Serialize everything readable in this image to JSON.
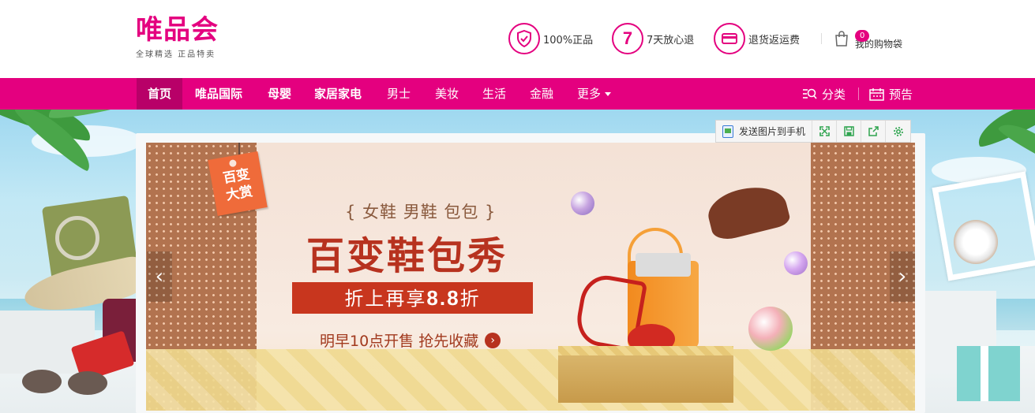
{
  "header": {
    "logo": {
      "main": "唯品会",
      "tagline": "全球精选  正品特卖"
    },
    "promises": [
      {
        "icon": "shield-icon",
        "text": "100%正品"
      },
      {
        "icon": "seven-day-icon",
        "badge": "7",
        "text": "7天放心退"
      },
      {
        "icon": "card-icon",
        "text": "退货返运费"
      }
    ],
    "cart": {
      "count": "0",
      "label": "我的购物袋"
    }
  },
  "nav": {
    "items": [
      {
        "label": "首页",
        "active": true
      },
      {
        "label": "唯品国际"
      },
      {
        "label": "母婴"
      },
      {
        "label": "家居家电"
      },
      {
        "label": "男士"
      },
      {
        "label": "美妆"
      },
      {
        "label": "生活"
      },
      {
        "label": "金融"
      },
      {
        "label": "更多"
      }
    ],
    "category": "分类",
    "preview": "预告"
  },
  "toolbar": {
    "send_label": "发送图片到手机"
  },
  "banner": {
    "tag": "百变\n大赏",
    "subtitle": "{ 女鞋 男鞋 包包 }",
    "title": "百变鞋包秀",
    "discount_prefix": "折上再享",
    "discount_value": "8.8",
    "discount_suffix": "折",
    "cta": "明早10点开售  抢先收藏"
  },
  "colors": {
    "brand": "#e4007f",
    "nav_active": "#b80068",
    "banner_red": "#c8361e"
  }
}
